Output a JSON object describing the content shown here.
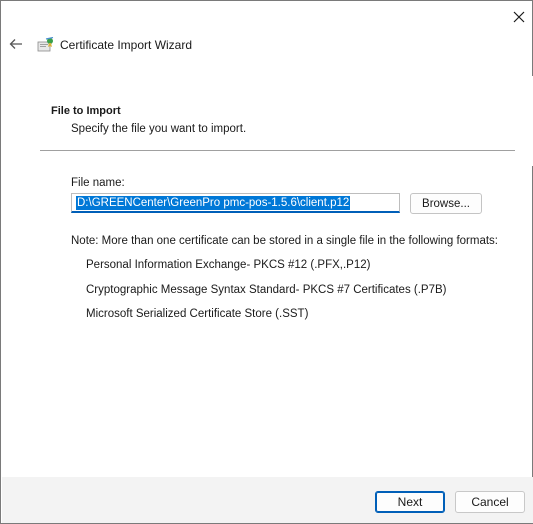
{
  "window": {
    "close_icon": "close-icon"
  },
  "header": {
    "back_icon": "back-arrow-icon",
    "app_icon": "certificate-wizard-icon",
    "title": "Certificate Import Wizard"
  },
  "section": {
    "title": "File to Import",
    "description": "Specify the file you want to import."
  },
  "file": {
    "label": "File name:",
    "value": "D:\\GREENCenter\\GreenPro pmc-pos-1.5.6\\client.p12",
    "browse_label": "Browse..."
  },
  "note": {
    "text": "Note:  More than one certificate can be stored in a single file in the following formats:",
    "formats": [
      "Personal Information Exchange- PKCS #12 (.PFX,.P12)",
      "Cryptographic Message Syntax Standard- PKCS #7 Certificates (.P7B)",
      "Microsoft Serialized Certificate Store (.SST)"
    ]
  },
  "footer": {
    "next_label": "Next",
    "cancel_label": "Cancel"
  },
  "colors": {
    "accent": "#005fb8",
    "selection": "#0078d7",
    "footer_bg": "#f3f3f3"
  }
}
